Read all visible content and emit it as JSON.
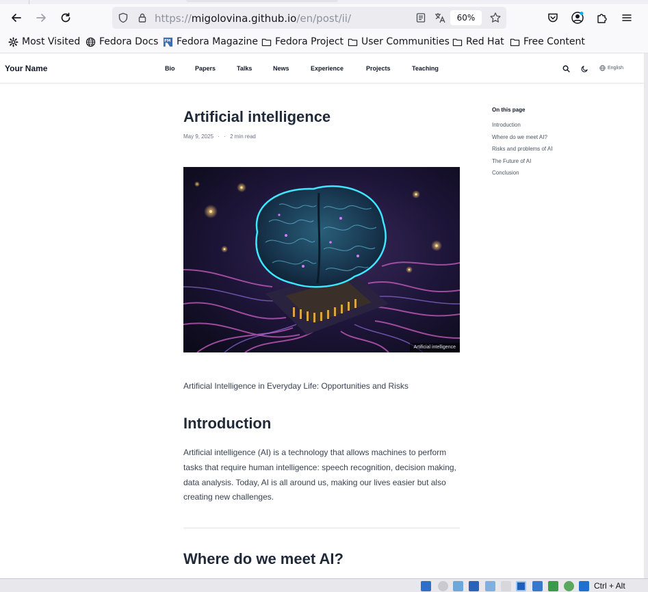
{
  "browser": {
    "url_prefix": "https://",
    "url_host": "migolovina.github.io",
    "url_path": "/en/post/ii/",
    "zoom": "60%",
    "bookmarks": [
      "Most Visited",
      "Fedora Docs",
      "Fedora Magazine",
      "Fedora Project",
      "User Communities",
      "Red Hat",
      "Free Content"
    ]
  },
  "site": {
    "title": "Your Name",
    "menu": [
      "Bio",
      "Papers",
      "Talks",
      "News",
      "Experience",
      "Projects",
      "Teaching"
    ],
    "language": "English"
  },
  "post": {
    "title": "Artificial intelligence",
    "date": "May 9, 2025",
    "sep1": "·",
    "sep2": "·",
    "read_time": "2 min read",
    "image_caption": "Artificial intelligence",
    "lead": "Artificial Intelligence in Everyday Life: Opportunities and Risks",
    "h2_intro": "Introduction",
    "intro_text": "Artificial intelligence (AI) is a technology that allows machines to perform tasks that require human intelligence: speech recognition, decision making, data analysis. Today, AI is all around us, making our lives easier but also creating new challenges.",
    "h2_where": "Where do we meet AI?"
  },
  "toc": {
    "heading": "On this page",
    "items": [
      "Introduction",
      "Where do we meet AI?",
      "Risks and problems of AI",
      "The Future of AI",
      "Conclusion"
    ]
  },
  "statusbar": {
    "host_key": "Ctrl + Alt"
  }
}
